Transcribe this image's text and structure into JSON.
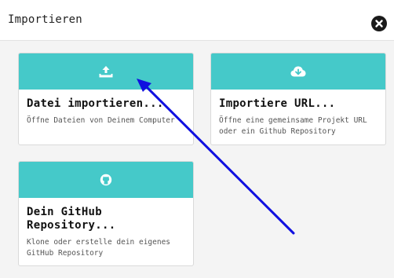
{
  "dialog": {
    "title": "Importieren",
    "close_icon": "close-circle-icon"
  },
  "cards": [
    {
      "icon": "upload-icon",
      "title": "Datei importieren...",
      "description": "Öffne Dateien von Deinem Computer"
    },
    {
      "icon": "cloud-download-icon",
      "title": "Importiere URL...",
      "description": "Öffne eine gemeinsame Projekt URL oder ein Github Repository"
    },
    {
      "icon": "github-icon",
      "title": "Dein GitHub Repository...",
      "description": "Klone oder erstelle dein eigenes GitHub Repository"
    }
  ],
  "colors": {
    "accent": "#45c9c9",
    "annotation_arrow": "#1010e0"
  }
}
